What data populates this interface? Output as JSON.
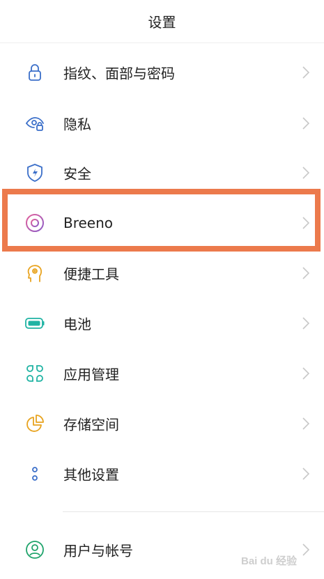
{
  "header": {
    "title": "设置"
  },
  "menu": {
    "items": [
      {
        "label": "指纹、面部与密码",
        "icon": "fingerprint-lock-icon"
      },
      {
        "label": "隐私",
        "icon": "privacy-eye-icon"
      },
      {
        "label": "安全",
        "icon": "security-shield-icon"
      },
      {
        "label": "Breeno",
        "icon": "breeno-icon"
      },
      {
        "label": "便捷工具",
        "icon": "convenience-tools-icon"
      },
      {
        "label": "电池",
        "icon": "battery-icon"
      },
      {
        "label": "应用管理",
        "icon": "app-management-icon"
      },
      {
        "label": "存储空间",
        "icon": "storage-icon"
      },
      {
        "label": "其他设置",
        "icon": "other-settings-icon"
      },
      {
        "label": "用户与帐号",
        "icon": "user-account-icon"
      }
    ]
  },
  "highlight": {
    "color": "#ec7a4c",
    "target": "Breeno"
  },
  "watermark": {
    "text": "Bai du 经验"
  }
}
